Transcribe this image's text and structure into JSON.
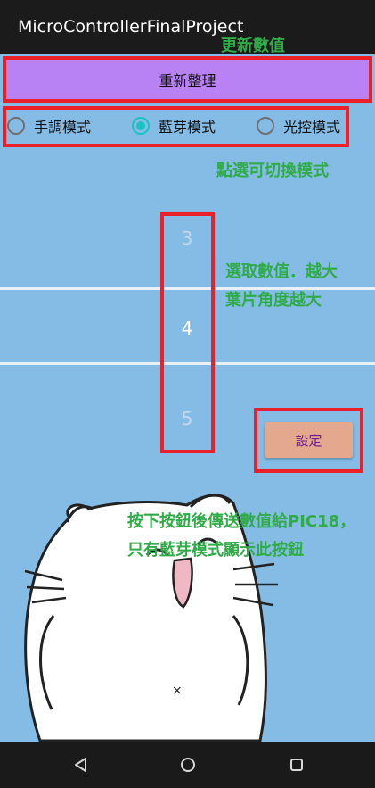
{
  "app": {
    "title": "MicroControllerFinalProject"
  },
  "annotations": {
    "refresh": "更新數值",
    "mode_switch": "點選可切換模式",
    "picker_line1": "選取數值．越大",
    "picker_line2": "葉片角度越大",
    "button_line1": "按下按鈕後傳送數值給PIC18，",
    "button_line2": "只有藍芽模式顯示此按鈕"
  },
  "refresh_button": {
    "label": "重新整理"
  },
  "modes": [
    {
      "label": "手調模式",
      "checked": false
    },
    {
      "label": "藍芽模式",
      "checked": true
    },
    {
      "label": "光控模式",
      "checked": false
    }
  ],
  "picker": {
    "above": "3",
    "selected": "4",
    "below": "5"
  },
  "set_button": {
    "label": "設定"
  },
  "cat_mouth_mark": "×",
  "nav": {
    "icons": [
      "back-icon",
      "home-icon",
      "recents-icon"
    ]
  },
  "colors": {
    "background": "#85bce6",
    "accent": "#19c3c3",
    "annotation": "#2fab47",
    "highlight_box": "#e8212a",
    "refresh_button": "#b882f4",
    "set_button": "#e4a88e"
  }
}
